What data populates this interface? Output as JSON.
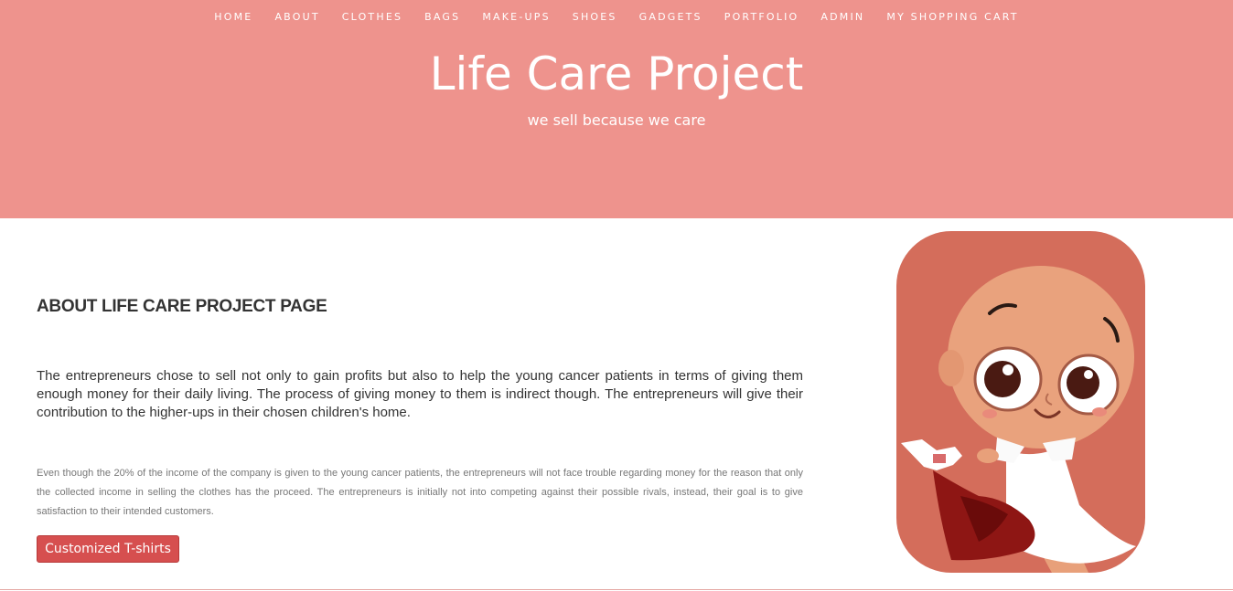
{
  "nav": {
    "items": [
      {
        "label": "HOME"
      },
      {
        "label": "ABOUT"
      },
      {
        "label": "CLOTHES"
      },
      {
        "label": "BAGS"
      },
      {
        "label": "MAKE-UPS"
      },
      {
        "label": "SHOES"
      },
      {
        "label": "GADGETS"
      },
      {
        "label": "PORTFOLIO"
      },
      {
        "label": "ADMIN"
      },
      {
        "label": "MY SHOPPING CART"
      }
    ]
  },
  "header": {
    "title": "Life Care Project",
    "tagline": "we sell because we care"
  },
  "main": {
    "heading": "ABOUT LIFE CARE PROJECT PAGE",
    "paragraph_main": "The entrepreneurs chose to sell not only to gain profits but also to help the young cancer patients in terms of giving them enough money for their daily living. The process of giving money to them is indirect though. The entrepreneurs will give their contribution to the higher-ups in their chosen children's home.",
    "paragraph_small": "Even though the 20% of the income of the company is given to the young cancer patients, the entrepreneurs will not face trouble regarding money for the reason that only the collected income in selling the clothes has the proceed. The entrepreneurs is initially not into competing against their possible rivals, instead, their goal is to give satisfaction to their intended customers.",
    "button_label": "Customized T-shirts"
  },
  "colors": {
    "header_bg": "#ee938d",
    "button_bg": "#d64f4f",
    "illustration_bg": "#d46d5b"
  }
}
